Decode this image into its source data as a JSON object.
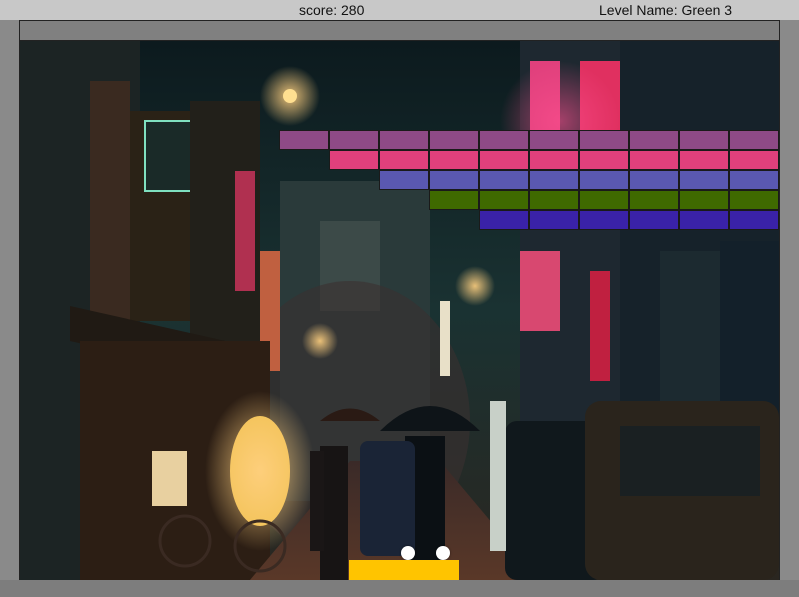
{
  "hud": {
    "score": "score: 280",
    "level": "Level Name: Green 3"
  },
  "bricks": {
    "rows": [
      {
        "color": "#8e4a86",
        "count": 10
      },
      {
        "color": "#e0407c",
        "count": 9
      },
      {
        "color": "#5a58b0",
        "count": 8
      },
      {
        "color": "#3f6a00",
        "count": 7
      },
      {
        "color": "#3a22a8",
        "count": 6
      }
    ]
  },
  "paddle": {
    "color": "#ffc400"
  },
  "balls": {
    "count": 2,
    "color": "#ffffff"
  },
  "colors": {
    "hud_bg": "#c8c8c8",
    "border": "#808080",
    "scene_night": "#1a2b2a",
    "neon_pink": "#e0407c",
    "street_light": "#ffb347"
  }
}
